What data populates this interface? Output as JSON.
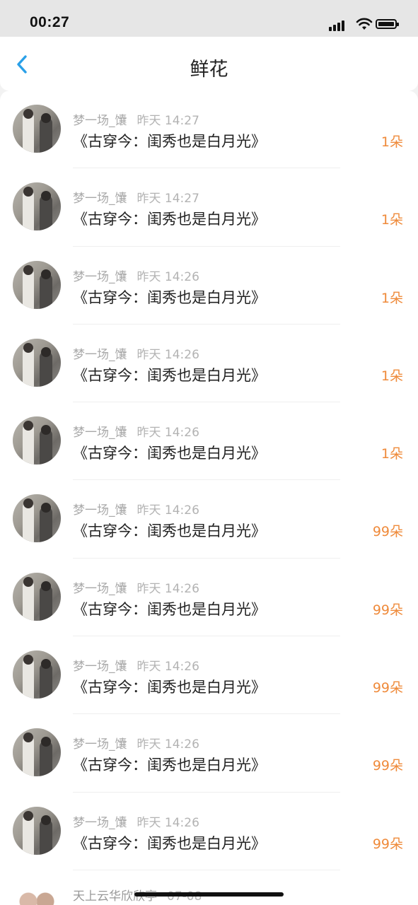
{
  "status_bar": {
    "time": "00:27"
  },
  "nav": {
    "title": "鲜花"
  },
  "colors": {
    "accent_back": "#2aa0e8",
    "count": "#ef8a3a"
  },
  "records": [
    {
      "user": "梦一场_馕",
      "time": "昨天 14:27",
      "book": "《古穿今：闺秀也是白月光》",
      "count": "1朵"
    },
    {
      "user": "梦一场_馕",
      "time": "昨天 14:27",
      "book": "《古穿今：闺秀也是白月光》",
      "count": "1朵"
    },
    {
      "user": "梦一场_馕",
      "time": "昨天 14:26",
      "book": "《古穿今：闺秀也是白月光》",
      "count": "1朵"
    },
    {
      "user": "梦一场_馕",
      "time": "昨天 14:26",
      "book": "《古穿今：闺秀也是白月光》",
      "count": "1朵"
    },
    {
      "user": "梦一场_馕",
      "time": "昨天 14:26",
      "book": "《古穿今：闺秀也是白月光》",
      "count": "1朵"
    },
    {
      "user": "梦一场_馕",
      "time": "昨天 14:26",
      "book": "《古穿今：闺秀也是白月光》",
      "count": "99朵"
    },
    {
      "user": "梦一场_馕",
      "time": "昨天 14:26",
      "book": "《古穿今：闺秀也是白月光》",
      "count": "99朵"
    },
    {
      "user": "梦一场_馕",
      "time": "昨天 14:26",
      "book": "《古穿今：闺秀也是白月光》",
      "count": "99朵"
    },
    {
      "user": "梦一场_馕",
      "time": "昨天 14:26",
      "book": "《古穿今：闺秀也是白月光》",
      "count": "99朵"
    },
    {
      "user": "梦一场_馕",
      "time": "昨天 14:26",
      "book": "《古穿今：闺秀也是白月光》",
      "count": "99朵"
    }
  ],
  "partial_record": {
    "user": "天上云华欣欣亭",
    "time": "07-08"
  }
}
